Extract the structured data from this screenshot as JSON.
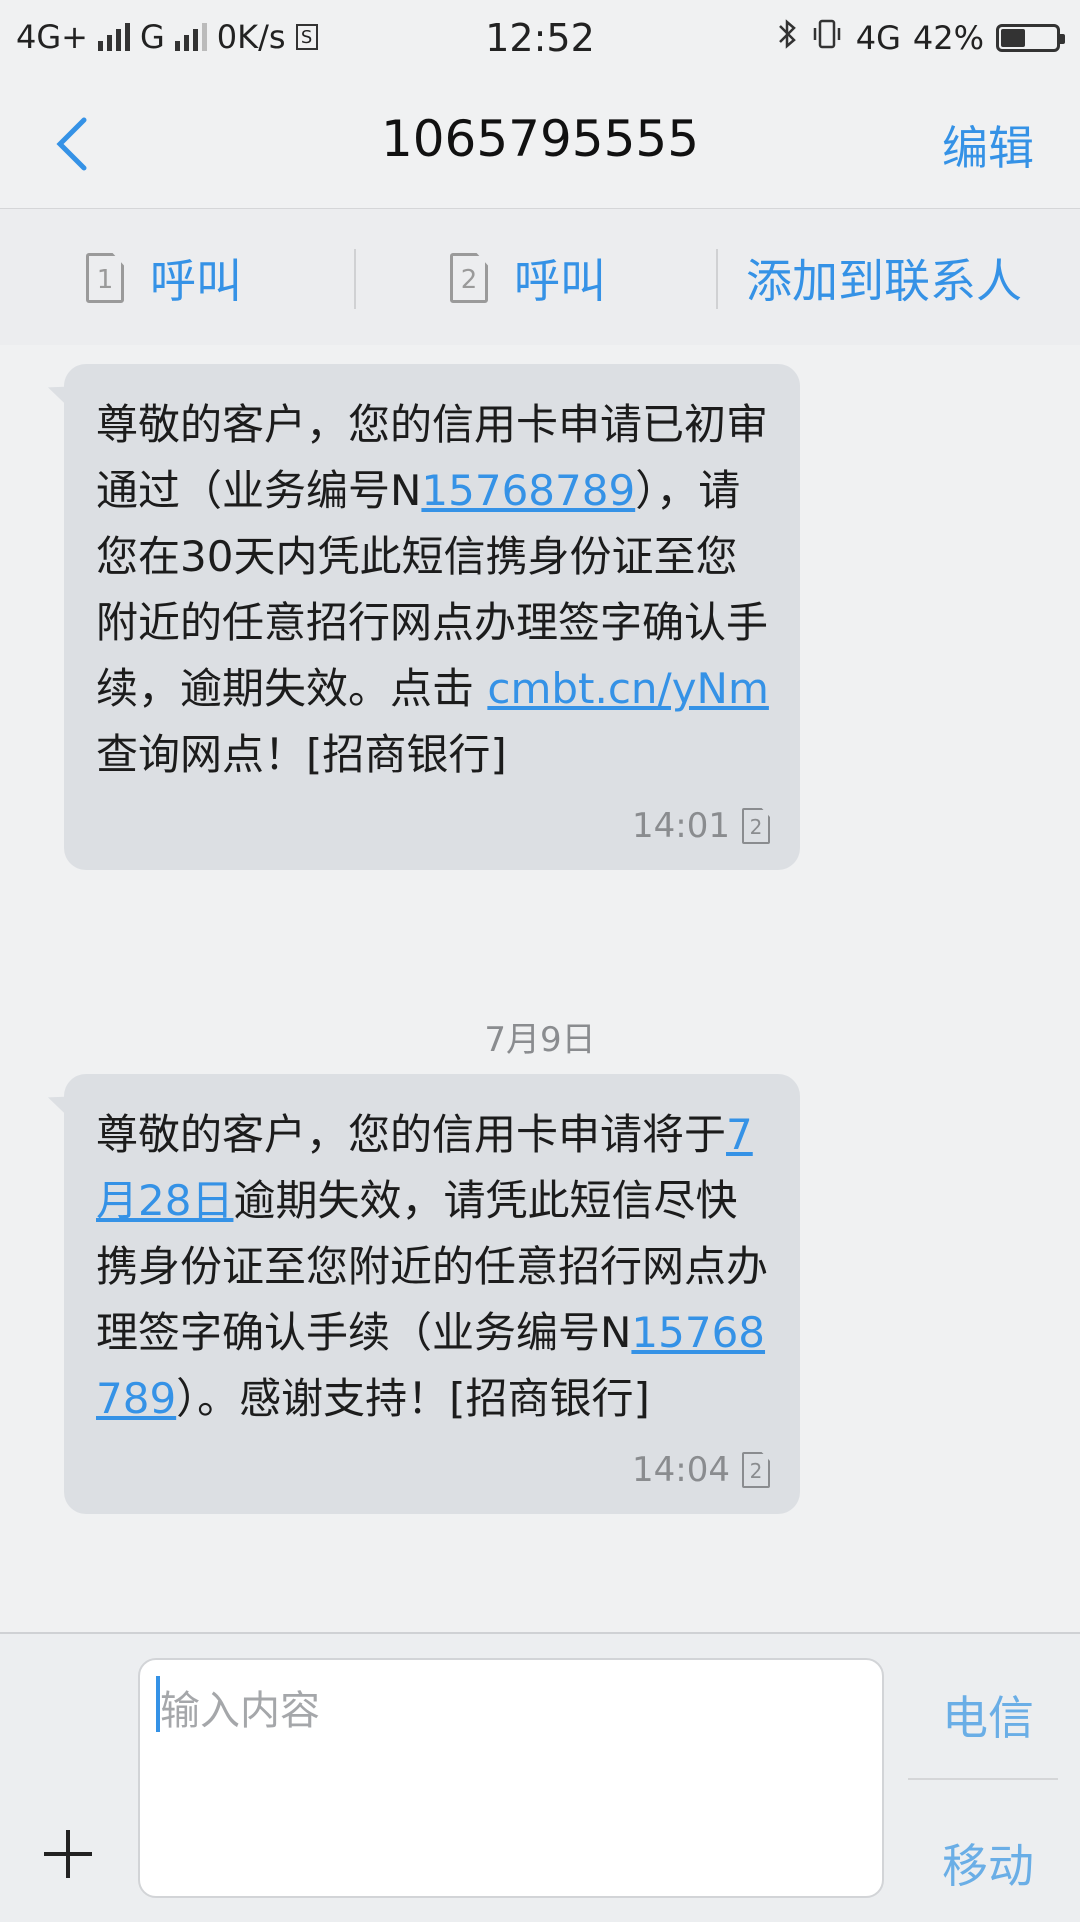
{
  "status_bar": {
    "network1": "4G+",
    "network2": "G",
    "speed": "0K/s",
    "time": "12:52",
    "network3": "4G",
    "battery": "42%"
  },
  "header": {
    "title": "1065795555",
    "edit_label": "编辑"
  },
  "actions": {
    "call_sim1_label": "呼叫",
    "call_sim2_label": "呼叫",
    "add_contact_label": "添加到联系人",
    "sim1": "1",
    "sim2": "2"
  },
  "messages": [
    {
      "text_a": "尊敬的客户，您的信用卡申请已初审通过（业务编号N",
      "link_a": "15768789",
      "text_b": "），请您在30天内凭此短信携身份证至您附近的任意招行网点办理签字确认手续，逾期失效。点击 ",
      "link_b": "cmbt.cn/yNm",
      "text_c": "查询网点！[招商银行]",
      "time": "14:01",
      "sim": "2"
    },
    {
      "text_a": "尊敬的客户，您的信用卡申请将于",
      "link_a": "7月28日",
      "text_b": "逾期失效，请凭此短信尽快携身份证至您附近的任意招行网点办理签字确认手续（业务编号N",
      "link_b": "15768789",
      "text_c": "）。感谢支持！[招商银行]",
      "time": "14:04",
      "sim": "2"
    }
  ],
  "date_separator": "7月9日",
  "composer": {
    "placeholder": "输入内容",
    "send_telecom": "电信",
    "send_mobile": "移动"
  },
  "colors": {
    "accent": "#3592e6",
    "bubble": "#dcdfe3",
    "background": "#f0f1f2"
  }
}
